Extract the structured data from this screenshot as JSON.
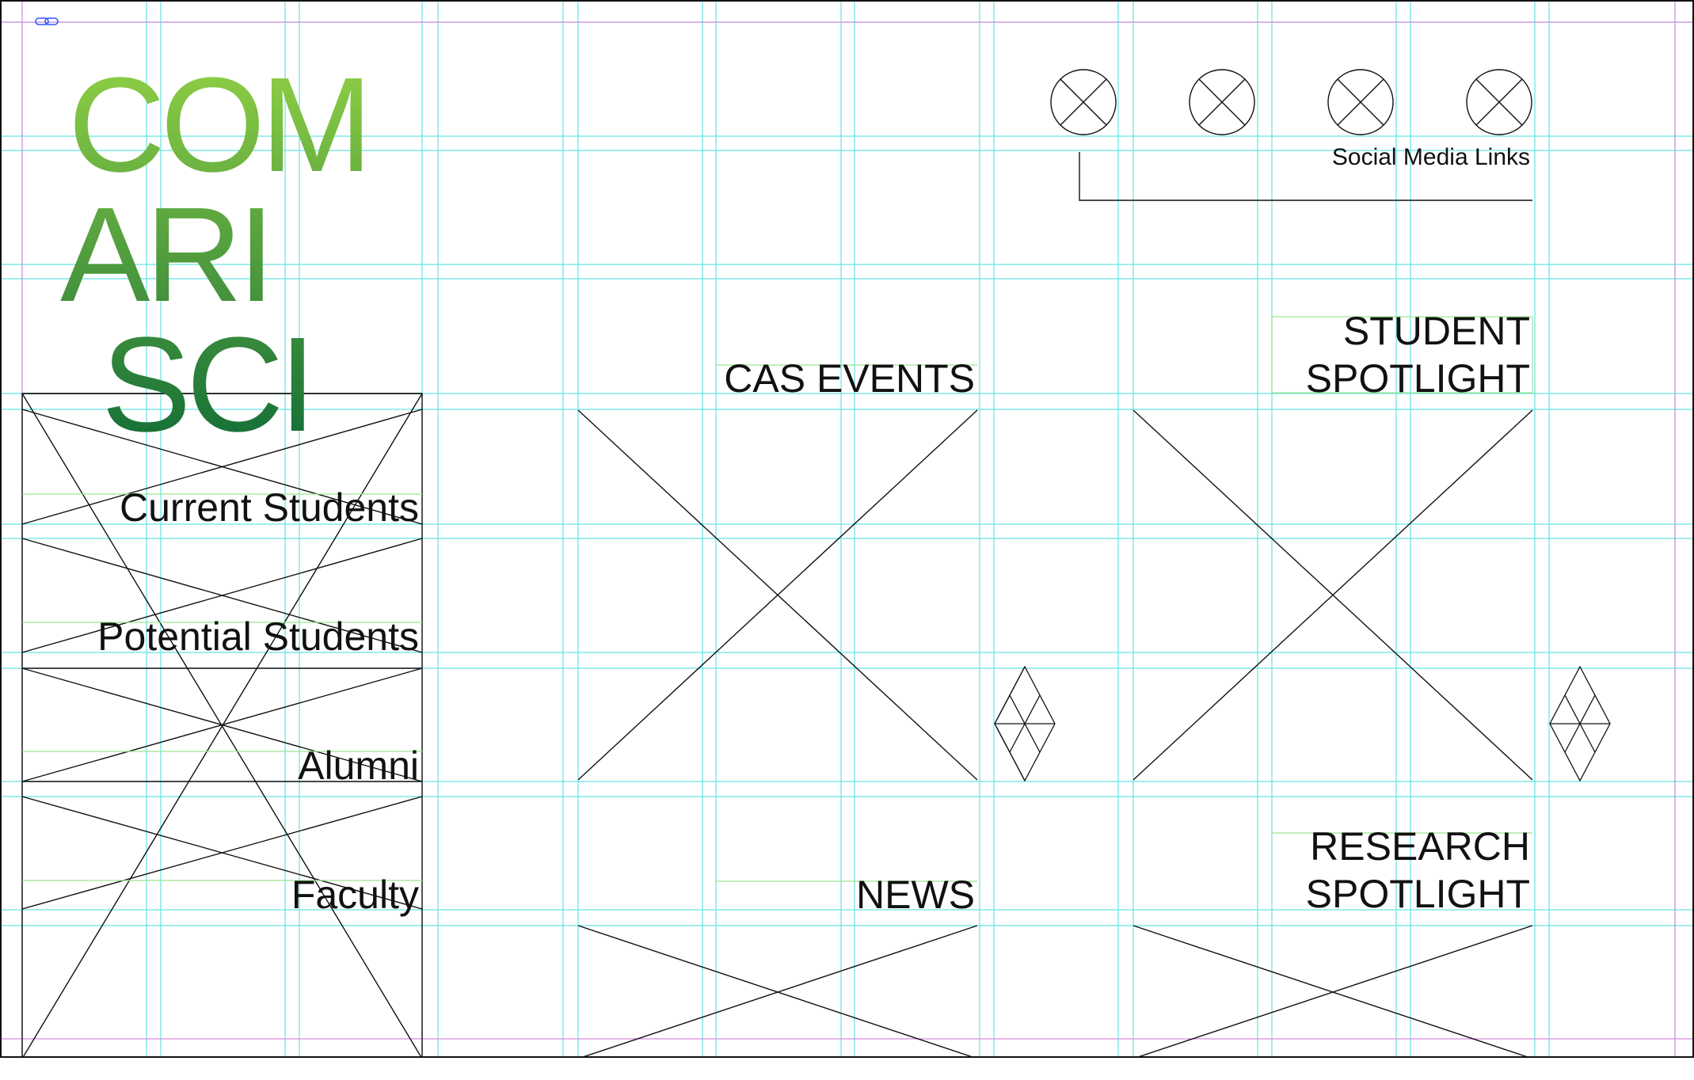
{
  "logo": {
    "lines": [
      "COM",
      "ARI",
      "SCI"
    ]
  },
  "nav": {
    "items": [
      {
        "label": "Current Students"
      },
      {
        "label": "Potential Students"
      },
      {
        "label": "Alumni"
      },
      {
        "label": "Faculty"
      }
    ]
  },
  "header": {
    "social_label": "Social Media Links",
    "social_icons": [
      "social-placeholder-icon",
      "social-placeholder-icon",
      "social-placeholder-icon",
      "social-placeholder-icon"
    ]
  },
  "sections": {
    "cas_events": {
      "title": "CAS EVENTS"
    },
    "student_spotlight": {
      "line1": "STUDENT",
      "line2": "SPOTLIGHT"
    },
    "news": {
      "title": "NEWS"
    },
    "research_spotlight": {
      "line1": "RESEARCH",
      "line2": "SPOTLIGHT"
    }
  },
  "colors": {
    "guide": "#66e3e3",
    "margin_guide": "#d88be0",
    "baseline_guide": "#9be58f",
    "wireframe": "#111111",
    "logo_top": "#8ccd44",
    "logo_bottom": "#0f6b36"
  }
}
